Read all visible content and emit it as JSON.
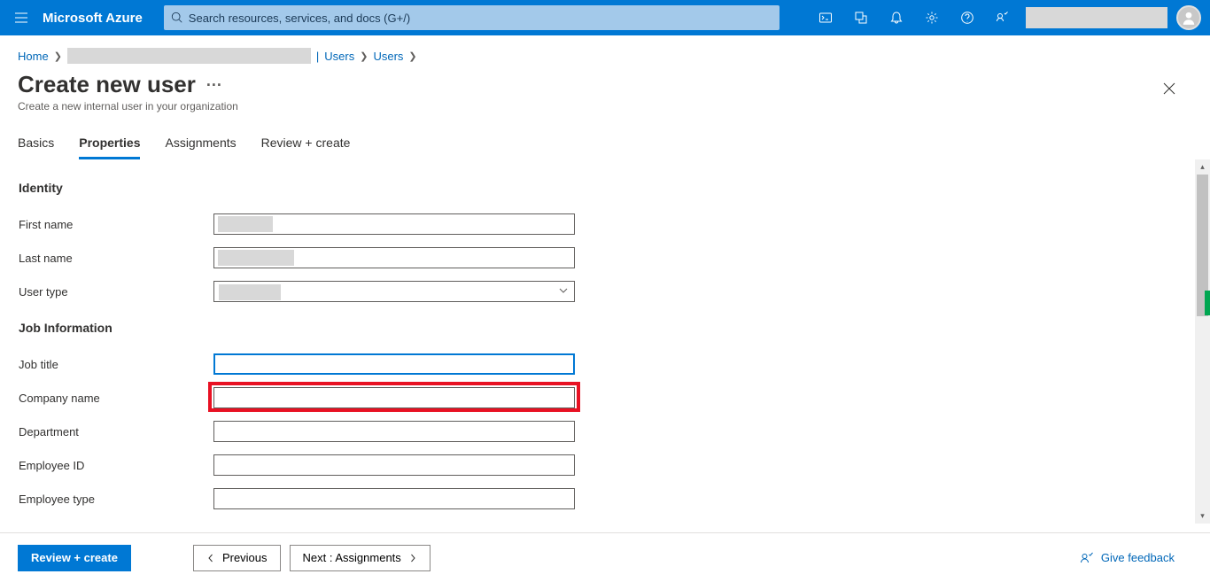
{
  "header": {
    "brand": "Microsoft Azure",
    "search_placeholder": "Search resources, services, and docs (G+/)"
  },
  "breadcrumb": {
    "home": "Home",
    "users1": "Users",
    "users2": "Users"
  },
  "page": {
    "title": "Create new user",
    "subtitle": "Create a new internal user in your organization"
  },
  "tabs": {
    "basics": "Basics",
    "properties": "Properties",
    "assignments": "Assignments",
    "review": "Review + create"
  },
  "sections": {
    "identity": "Identity",
    "job": "Job Information"
  },
  "fields": {
    "first_name": {
      "label": "First name",
      "value": ""
    },
    "last_name": {
      "label": "Last name",
      "value": ""
    },
    "user_type": {
      "label": "User type",
      "value": ""
    },
    "job_title": {
      "label": "Job title",
      "value": ""
    },
    "company_name": {
      "label": "Company name",
      "value": ""
    },
    "department": {
      "label": "Department",
      "value": ""
    },
    "employee_id": {
      "label": "Employee ID",
      "value": ""
    },
    "employee_type": {
      "label": "Employee type",
      "value": ""
    }
  },
  "footer": {
    "review": "Review + create",
    "previous": "Previous",
    "next": "Next : Assignments",
    "feedback": "Give feedback"
  }
}
